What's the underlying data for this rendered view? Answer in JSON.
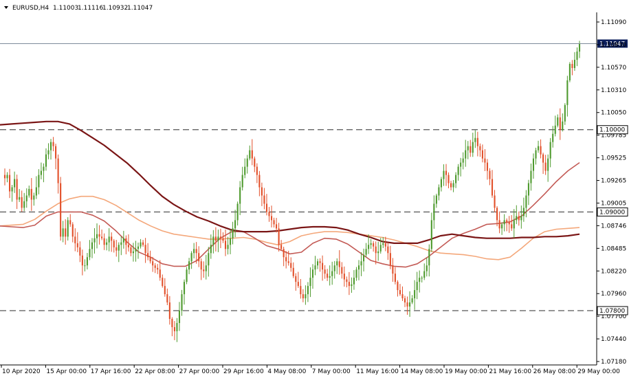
{
  "header": {
    "symbol": "EURUSD,H4",
    "open": "1.11003",
    "high": "1.11116",
    "low": "1.10932",
    "close": "1.11047"
  },
  "chart_data": {
    "type": "candlestick",
    "ylim": [
      1.0714,
      1.1141
    ],
    "y_ticks": [
      "1.11090",
      "1.10830",
      "1.10570",
      "1.10310",
      "1.10050",
      "1.09785",
      "1.09525",
      "1.09265",
      "1.09005",
      "1.08746",
      "1.08485",
      "1.08220",
      "1.07960",
      "1.07700",
      "1.07440",
      "1.07180"
    ],
    "x_ticks": [
      "10 Apr 2020",
      "15 Apr 00:00",
      "17 Apr 16:00",
      "22 Apr 08:00",
      "27 Apr 00:00",
      "29 Apr 16:00",
      "4 May 08:00",
      "7 May 00:00",
      "11 May 16:00",
      "14 May 08:00",
      "19 May 00:00",
      "21 May 16:00",
      "26 May 08:00",
      "29 May 00:00"
    ],
    "levels": [
      {
        "value": 1.1,
        "label": "1.10000"
      },
      {
        "value": 1.09,
        "label": "1.09000"
      },
      {
        "value": 1.078,
        "label": "1.07800"
      }
    ],
    "price_line": {
      "value": 1.11047,
      "label": "1.11047"
    },
    "colors": {
      "bull": "#4e9a2e",
      "bear": "#e2502a",
      "ma_fast": "#f4a77a",
      "ma_mid": "#c35a55",
      "ma_slow": "#7a1515"
    },
    "closes": [
      1.0941,
      1.0945,
      1.0925,
      1.093,
      1.094,
      1.0915,
      1.0918,
      1.0905,
      1.0913,
      1.092,
      1.0928,
      1.0915,
      1.092,
      1.093,
      1.0945,
      1.095,
      1.0955,
      1.097,
      1.0975,
      1.0985,
      1.098,
      1.0965,
      1.0935,
      1.087,
      1.088,
      1.087,
      1.089,
      1.0885,
      1.087,
      1.0862,
      1.0857,
      1.0847,
      1.0835,
      1.0835,
      1.0845,
      1.0855,
      1.0863,
      1.0868,
      1.0873,
      1.087,
      1.0868,
      1.086,
      1.0863,
      1.087,
      1.0865,
      1.0857,
      1.0853,
      1.086,
      1.0863,
      1.0868,
      1.086,
      1.0857,
      1.085,
      1.0852,
      1.0855,
      1.0858,
      1.0863,
      1.086,
      1.085,
      1.0845,
      1.084,
      1.0835,
      1.0832,
      1.083,
      1.082,
      1.081,
      1.08,
      1.079,
      1.077,
      1.076,
      1.0755,
      1.0765,
      1.078,
      1.08,
      1.0815,
      1.083,
      1.084,
      1.085,
      1.0855,
      1.085,
      1.084,
      1.083,
      1.0828,
      1.0835,
      1.085,
      1.086,
      1.087,
      1.0865,
      1.087,
      1.0868,
      1.0865,
      1.0855,
      1.086,
      1.0868,
      1.088,
      1.089,
      1.091,
      1.093,
      1.0945,
      1.0955,
      1.0965,
      1.0975,
      1.0965,
      1.0955,
      1.0945,
      1.093,
      1.092,
      1.091,
      1.09,
      1.0895,
      1.089,
      1.0885,
      1.088,
      1.086,
      1.0855,
      1.0845,
      1.084,
      1.0838,
      1.0832,
      1.0822,
      1.0815,
      1.081,
      1.08,
      1.0795,
      1.08,
      1.081,
      1.082,
      1.083,
      1.0835,
      1.084,
      1.0838,
      1.083,
      1.0825,
      1.082,
      1.0822,
      1.0828,
      1.0835,
      1.084,
      1.0833,
      1.0825,
      1.0818,
      1.0815,
      1.081,
      1.0812,
      1.082,
      1.083,
      1.0835,
      1.084,
      1.0848,
      1.0855,
      1.086,
      1.0862,
      1.0858,
      1.085,
      1.0852,
      1.086,
      1.0862,
      1.0858,
      1.085,
      1.0835,
      1.0825,
      1.0815,
      1.0805,
      1.08,
      1.0795,
      1.079,
      1.0785,
      1.079,
      1.0795,
      1.0805,
      1.0815,
      1.082,
      1.082,
      1.0828,
      1.0835,
      1.0855,
      1.089,
      1.091,
      1.092,
      1.093,
      1.094,
      1.095,
      1.0945,
      1.0935,
      1.093,
      1.0935,
      1.0945,
      1.0955,
      1.096,
      1.0965,
      1.0975,
      1.098,
      1.0972,
      1.0985,
      1.099,
      1.098,
      1.0975,
      1.0965,
      1.096,
      1.095,
      1.094,
      1.092,
      1.0905,
      1.089,
      1.088,
      1.0885,
      1.089,
      1.0888,
      1.0885,
      1.088,
      1.089,
      1.0895,
      1.089,
      1.0895,
      1.0905,
      1.092,
      1.0935,
      1.095,
      1.0965,
      1.0975,
      1.098,
      1.097,
      1.096,
      1.095,
      1.0965,
      1.0985,
      1.0995,
      1.1005,
      1.1015,
      1.1,
      1.101,
      1.103,
      1.106,
      1.108,
      1.1075,
      1.1085,
      1.1095,
      1.1105
    ],
    "series": [
      {
        "values": [
          1.0883,
          1.0884,
          1.0885,
          1.0891,
          1.0901,
          1.091,
          1.0916,
          1.0919,
          1.0919,
          1.0915,
          1.0908,
          1.0899,
          1.089,
          1.0883,
          1.0877,
          1.0873,
          1.0871,
          1.0869,
          1.0867,
          1.0867,
          1.0868,
          1.0869,
          1.0867,
          1.0863,
          1.086,
          1.0864,
          1.0871,
          1.0874,
          1.0876,
          1.0876,
          1.0875,
          1.0873,
          1.0871,
          1.0869,
          1.0866,
          1.0862,
          1.0858,
          1.0853,
          1.085,
          1.0849,
          1.0848,
          1.0846,
          1.0843,
          1.0842,
          1.0845,
          1.0856,
          1.0868,
          1.0876,
          1.0879,
          1.088,
          1.0881
        ]
      },
      {
        "values": [
          1.0883,
          1.0882,
          1.0881,
          1.0884,
          1.0895,
          1.09,
          1.09,
          1.09,
          1.0896,
          1.0889,
          1.0877,
          1.0863,
          1.0851,
          1.0845,
          1.0837,
          1.0834,
          1.0834,
          1.0841,
          1.0855,
          1.0868,
          1.0876,
          1.0876,
          1.0868,
          1.0859,
          1.0855,
          1.0849,
          1.0851,
          1.0862,
          1.0868,
          1.0867,
          1.0861,
          1.0851,
          1.0841,
          1.0837,
          1.0834,
          1.0833,
          1.0837,
          1.0846,
          1.0857,
          1.0868,
          1.0874,
          1.0879,
          1.0885,
          1.0886,
          1.0888,
          1.0895,
          1.0908,
          1.0922,
          1.0937,
          1.095,
          1.096
        ]
      },
      {
        "values": [
          1.1006,
          1.1007,
          1.1008,
          1.1009,
          1.101,
          1.101,
          1.1007,
          1.0999,
          1.099,
          1.0981,
          1.097,
          1.0959,
          1.0946,
          1.0932,
          1.0919,
          1.0909,
          1.0901,
          1.0894,
          1.0889,
          1.0883,
          1.0878,
          1.0876,
          1.0876,
          1.0876,
          1.0877,
          1.0879,
          1.0881,
          1.0882,
          1.0882,
          1.0881,
          1.0878,
          1.0873,
          1.0869,
          1.0864,
          1.0862,
          1.0862,
          1.0862,
          1.0866,
          1.0871,
          1.0873,
          1.0871,
          1.0869,
          1.0868,
          1.0868,
          1.0868,
          1.0869,
          1.0869,
          1.087,
          1.087,
          1.0871,
          1.0873
        ]
      }
    ]
  }
}
